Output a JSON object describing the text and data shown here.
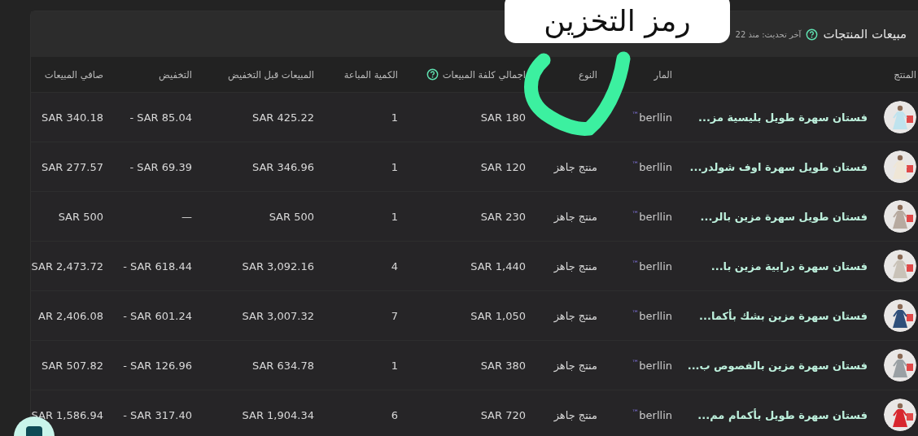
{
  "annotation": {
    "label": "رمز التخزين"
  },
  "card": {
    "title": "مبيعات المنتجات",
    "title_help": true,
    "updated": "آخر تحديث: منذ 22"
  },
  "table": {
    "columns": [
      {
        "label": "المنتج",
        "help": false
      },
      {
        "label": "المار",
        "help": false
      },
      {
        "label": "النوع",
        "help": false
      },
      {
        "label": "اجمالي كلفة المبيعات",
        "help": true
      },
      {
        "label": "الكمية المباعة",
        "help": false
      },
      {
        "label": "المبيعات قبل التخفيض",
        "help": false
      },
      {
        "label": "التخفيض",
        "help": false
      },
      {
        "label": "صافي المبيعات",
        "help": false
      }
    ],
    "rows": [
      {
        "product": "فستان سهرة طويل بليسية مز...",
        "brand": "berllin$^{™}$",
        "cost": "SAR 180",
        "qty": "1",
        "before": "SAR 425.22",
        "discount": "SAR 85.04 -",
        "net": "SAR 340.18"
      },
      {
        "product": "فستان طويل سهرة اوف شولدر...",
        "brand": "berllin$^{™}$",
        "type": "منتج جاهز",
        "cost": "SAR 120",
        "qty": "1",
        "before": "SAR 346.96",
        "discount": "SAR 69.39 -",
        "net": "SAR 277.57"
      },
      {
        "product": "فستان طويل سهرة مزين بالر...",
        "brand": "berllin$^{™}$",
        "type": "منتج جاهز",
        "cost": "SAR 230",
        "qty": "1",
        "before": "SAR 500",
        "discount": "—",
        "net": "SAR 500"
      },
      {
        "product": "فستان سهرة درابية مزين با...",
        "brand": "berllin$^{™}$",
        "type": "منتج جاهز",
        "cost": "SAR 1,440",
        "qty": "4",
        "before": "SAR 3,092.16",
        "discount": "SAR 618.44 -",
        "net": "SAR 2,473.72"
      },
      {
        "product": "فستان سهرة مزين بشك بأكما...",
        "brand": "berllin$^{™}$",
        "type": "منتج جاهز",
        "cost": "SAR 1,050",
        "qty": "7",
        "before": "SAR 3,007.32",
        "discount": "SAR 601.24 -",
        "net": "AR 2,406.08"
      },
      {
        "product": "فستان سهرة مزين بالفصوص ب...",
        "brand": "berllin$^{™}$",
        "type": "منتج جاهز",
        "cost": "SAR 380",
        "qty": "1",
        "before": "SAR 634.78",
        "discount": "SAR 126.96 -",
        "net": "SAR 507.82"
      },
      {
        "product": "فستان سهرة طويل بأكمام مم...",
        "brand": "berllin$^{™}$",
        "type": "منتج جاهز",
        "cost": "SAR 720",
        "qty": "6",
        "before": "SAR 1,904.34",
        "discount": "SAR 317.40 -",
        "net": "SAR 1,586.94"
      }
    ]
  }
}
